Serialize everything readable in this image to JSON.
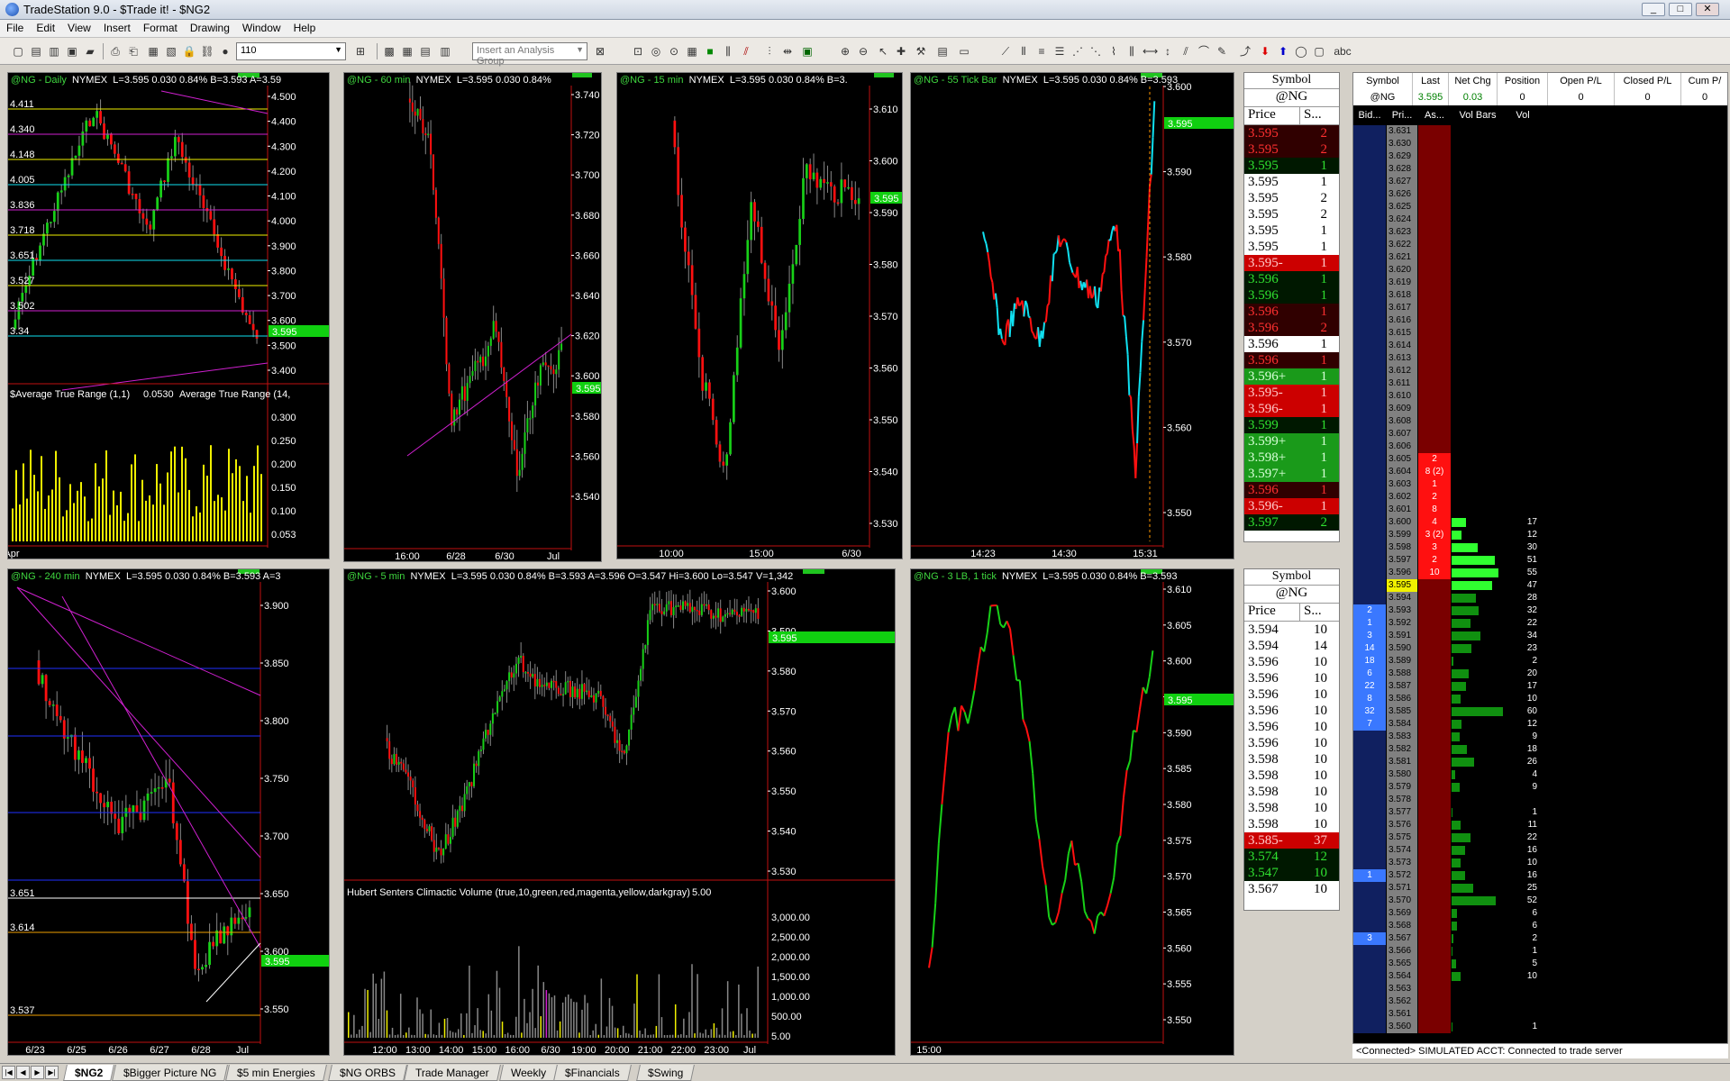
{
  "window": {
    "title": "TradeStation 9.0 - $Trade it! - $NG2",
    "min": "_",
    "max": "□",
    "close": "✕"
  },
  "menu": [
    "File",
    "Edit",
    "View",
    "Insert",
    "Format",
    "Drawing",
    "Window",
    "Help"
  ],
  "toolbar": {
    "interval_value": "110",
    "analysis_group_placeholder": "Insert an Analysis Group"
  },
  "charts": {
    "daily": {
      "title": "@NG - Daily",
      "exchange": "NYMEX",
      "info": "L=3.595  0.030  0.84%  B=3.593  A=3.59",
      "price_ticks": [
        "4.500",
        "4.400",
        "4.300",
        "4.200",
        "4.100",
        "4.000",
        "3.900",
        "3.800",
        "3.700",
        "3.600",
        "3.500",
        "3.400"
      ],
      "level_labels": [
        "4.411",
        "4.340",
        "4.148",
        "4.005",
        "3.836",
        "3.718",
        "3.651",
        "3.527",
        "3.502",
        "3.34"
      ],
      "indicator": "$Average True Range (1,1)",
      "indicator_val": "0.0530",
      "indicator2": "Average True Range (14,",
      "ind_ticks": [
        "0.300",
        "0.250",
        "0.200",
        "0.150",
        "0.100",
        "0.053"
      ],
      "last_tag": "3.595",
      "x_labels": [
        "Apr"
      ]
    },
    "m60": {
      "title": "@NG - 60 min",
      "exchange": "NYMEX",
      "info": "L=3.595  0.030  0.84%",
      "price_ticks": [
        "3.740",
        "3.720",
        "3.700",
        "3.680",
        "3.660",
        "3.640",
        "3.620",
        "3.600",
        "3.580",
        "3.560",
        "3.540"
      ],
      "last_tag": "3.595",
      "x_labels": [
        "16:00",
        "6/28",
        "6/30",
        "Jul"
      ]
    },
    "m15": {
      "title": "@NG - 15 min",
      "exchange": "NYMEX",
      "info": "L=3.595  0.030  0.84%  B=3.",
      "price_ticks": [
        "3.610",
        "3.600",
        "3.590",
        "3.580",
        "3.570",
        "3.560",
        "3.550",
        "3.540",
        "3.530"
      ],
      "last_tag": "3.595",
      "x_labels": [
        "10:00",
        "15:00",
        "6/30"
      ]
    },
    "tick55": {
      "title": "@NG - 55 Tick Bar",
      "exchange": "NYMEX",
      "info": "L=3.595  0.030  0.84%  B=3.593",
      "price_ticks": [
        "3.600",
        "3.590",
        "3.580",
        "3.570",
        "3.560",
        "3.550"
      ],
      "last_tag": "3.595",
      "x_labels": [
        "14:23",
        "14:30",
        "15:31"
      ]
    },
    "m240": {
      "title": "@NG - 240 min",
      "exchange": "NYMEX",
      "info": "L=3.595  0.030  0.84%  B=3.593  A=3",
      "price_ticks": [
        "3.900",
        "3.850",
        "3.800",
        "3.750",
        "3.700",
        "3.650",
        "3.600",
        "3.550"
      ],
      "level_labels": [
        "3.651",
        "3.614",
        "3.537"
      ],
      "last_tag": "3.595",
      "x_labels": [
        "6/23",
        "6/25",
        "6/26",
        "6/27",
        "6/28",
        "Jul"
      ]
    },
    "m5": {
      "title": "@NG - 5 min",
      "exchange": "NYMEX",
      "info": "L=3.595  0.030  0.84%  B=3.593  A=3.596  O=3.547  Hi=3.600  Lo=3.547  V=1,342",
      "price_ticks": [
        "3.600",
        "3.590",
        "3.580",
        "3.570",
        "3.560",
        "3.550",
        "3.540",
        "3.530"
      ],
      "indicator": "Hubert Senters Climactic Volume (true,10,green,red,magenta,yellow,darkgray)",
      "indicator_val": "5.00",
      "vol_ticks": [
        "3,000.00",
        "2,500.00",
        "2,000.00",
        "1,500.00",
        "1,000.00",
        "500.00",
        "5.00"
      ],
      "last_tag": "3.595",
      "x_labels": [
        "12:00",
        "13:00",
        "14:00",
        "15:00",
        "16:00",
        "6/30",
        "19:00",
        "20:00",
        "21:00",
        "22:00",
        "23:00",
        "Jul"
      ]
    },
    "lb3": {
      "title": "@NG - 3 LB, 1 tick",
      "exchange": "NYMEX",
      "info": "L=3.595  0.030  0.84%  B=3.593",
      "price_ticks": [
        "3.610",
        "3.605",
        "3.600",
        "3.595",
        "3.590",
        "3.585",
        "3.580",
        "3.575",
        "3.570",
        "3.565",
        "3.560",
        "3.555",
        "3.550"
      ],
      "last_tag": "3.595",
      "x_labels": [
        "15:00"
      ]
    }
  },
  "time_sales_1": {
    "sym_head": "Symbol",
    "symbol": "@NG",
    "col_price": "Price",
    "col_size": "S...",
    "rows": [
      [
        "3.595",
        "2",
        "dred"
      ],
      [
        "3.595",
        "2",
        "dred"
      ],
      [
        "3.595",
        "1",
        "dgreen"
      ],
      [
        "3.595",
        "1",
        "white"
      ],
      [
        "3.595",
        "2",
        "white"
      ],
      [
        "3.595",
        "2",
        "white"
      ],
      [
        "3.595",
        "1",
        "white"
      ],
      [
        "3.595",
        "1",
        "white"
      ],
      [
        "3.595-",
        "1",
        "red"
      ],
      [
        "3.596",
        "1",
        "dgreen"
      ],
      [
        "3.596",
        "1",
        "dgreen"
      ],
      [
        "3.596",
        "1",
        "dred"
      ],
      [
        "3.596",
        "2",
        "dred"
      ],
      [
        "3.596",
        "1",
        "white"
      ],
      [
        "3.596",
        "1",
        "dred"
      ],
      [
        "3.596+",
        "1",
        "green"
      ],
      [
        "3.595-",
        "1",
        "red"
      ],
      [
        "3.596-",
        "1",
        "red"
      ],
      [
        "3.599",
        "1",
        "dgreen"
      ],
      [
        "3.599+",
        "1",
        "green"
      ],
      [
        "3.598+",
        "1",
        "green"
      ],
      [
        "3.597+",
        "1",
        "green"
      ],
      [
        "3.596",
        "1",
        "dred"
      ],
      [
        "3.596-",
        "1",
        "red"
      ],
      [
        "3.597",
        "2",
        "dgreen"
      ]
    ]
  },
  "time_sales_2": {
    "sym_head": "Symbol",
    "symbol": "@NG",
    "col_price": "Price",
    "col_size": "S...",
    "rows": [
      [
        "3.594",
        "10",
        "white"
      ],
      [
        "3.594",
        "14",
        "white"
      ],
      [
        "3.596",
        "10",
        "white"
      ],
      [
        "3.596",
        "10",
        "white"
      ],
      [
        "3.596",
        "10",
        "white"
      ],
      [
        "3.596",
        "10",
        "white"
      ],
      [
        "3.596",
        "10",
        "white"
      ],
      [
        "3.596",
        "10",
        "white"
      ],
      [
        "3.598",
        "10",
        "white"
      ],
      [
        "3.598",
        "10",
        "white"
      ],
      [
        "3.598",
        "10",
        "white"
      ],
      [
        "3.598",
        "10",
        "white"
      ],
      [
        "3.598",
        "10",
        "white"
      ],
      [
        "3.585-",
        "37",
        "red"
      ],
      [
        "3.574",
        "12",
        "dgreen"
      ],
      [
        "3.547",
        "10",
        "dgreen"
      ],
      [
        "3.567",
        "10",
        "white"
      ]
    ]
  },
  "dom": {
    "headers": [
      "Symbol",
      "Last",
      "Net Chg",
      "Position",
      "Open P/L",
      "Closed P/L",
      "Cum P/"
    ],
    "values": [
      "@NG",
      "3.595",
      "0.03",
      "0",
      "0",
      "0",
      "0"
    ],
    "sub_headers": [
      "Bid...",
      "Pri...",
      "As...",
      "Vol Bars",
      "Vol"
    ],
    "ladder": [
      [
        "",
        "3.631",
        "",
        ""
      ],
      [
        "",
        "3.630",
        "",
        ""
      ],
      [
        "",
        "3.629",
        "",
        ""
      ],
      [
        "",
        "3.628",
        "",
        ""
      ],
      [
        "",
        "3.627",
        "",
        ""
      ],
      [
        "",
        "3.626",
        "",
        ""
      ],
      [
        "",
        "3.625",
        "",
        ""
      ],
      [
        "",
        "3.624",
        "",
        ""
      ],
      [
        "",
        "3.623",
        "",
        ""
      ],
      [
        "",
        "3.622",
        "",
        ""
      ],
      [
        "",
        "3.621",
        "",
        ""
      ],
      [
        "",
        "3.620",
        "",
        ""
      ],
      [
        "",
        "3.619",
        "",
        ""
      ],
      [
        "",
        "3.618",
        "",
        ""
      ],
      [
        "",
        "3.617",
        "",
        ""
      ],
      [
        "",
        "3.616",
        "",
        ""
      ],
      [
        "",
        "3.615",
        "",
        ""
      ],
      [
        "",
        "3.614",
        "",
        ""
      ],
      [
        "",
        "3.613",
        "",
        ""
      ],
      [
        "",
        "3.612",
        "",
        ""
      ],
      [
        "",
        "3.611",
        "",
        ""
      ],
      [
        "",
        "3.610",
        "",
        ""
      ],
      [
        "",
        "3.609",
        "",
        ""
      ],
      [
        "",
        "3.608",
        "",
        ""
      ],
      [
        "",
        "3.607",
        "",
        ""
      ],
      [
        "",
        "3.606",
        "",
        ""
      ],
      [
        "",
        "3.605",
        "2",
        ""
      ],
      [
        "",
        "3.604",
        "8 (2)",
        ""
      ],
      [
        "",
        "3.603",
        "1",
        ""
      ],
      [
        "",
        "3.602",
        "2",
        ""
      ],
      [
        "",
        "3.601",
        "8",
        ""
      ],
      [
        "",
        "3.600",
        "4",
        "17"
      ],
      [
        "",
        "3.599",
        "3 (2)",
        "12"
      ],
      [
        "",
        "3.598",
        "3",
        "30"
      ],
      [
        "",
        "3.597",
        "2",
        "51"
      ],
      [
        "",
        "3.596",
        "10",
        "55"
      ],
      [
        "",
        "3.595",
        "",
        "47"
      ],
      [
        "",
        "3.594",
        "",
        "28"
      ],
      [
        "2",
        "3.593",
        "",
        "32"
      ],
      [
        "1",
        "3.592",
        "",
        "22"
      ],
      [
        "3",
        "3.591",
        "",
        "34"
      ],
      [
        "14",
        "3.590",
        "",
        "23"
      ],
      [
        "18",
        "3.589",
        "",
        "2"
      ],
      [
        "6",
        "3.588",
        "",
        "20"
      ],
      [
        "22",
        "3.587",
        "",
        "17"
      ],
      [
        "8",
        "3.586",
        "",
        "10"
      ],
      [
        "32",
        "3.585",
        "",
        "60"
      ],
      [
        "7",
        "3.584",
        "",
        "12"
      ],
      [
        "",
        "3.583",
        "",
        "9"
      ],
      [
        "",
        "3.582",
        "",
        "18"
      ],
      [
        "",
        "3.581",
        "",
        "26"
      ],
      [
        "",
        "3.580",
        "",
        "4"
      ],
      [
        "",
        "3.579",
        "",
        "9"
      ],
      [
        "",
        "3.578",
        "",
        ""
      ],
      [
        "",
        "3.577",
        "",
        "1"
      ],
      [
        "",
        "3.576",
        "",
        "11"
      ],
      [
        "",
        "3.575",
        "",
        "22"
      ],
      [
        "",
        "3.574",
        "",
        "16"
      ],
      [
        "",
        "3.573",
        "",
        "10"
      ],
      [
        "1",
        "3.572",
        "",
        "16"
      ],
      [
        "",
        "3.571",
        "",
        "25"
      ],
      [
        "",
        "3.570",
        "",
        "52"
      ],
      [
        "",
        "3.569",
        "",
        "6"
      ],
      [
        "",
        "3.568",
        "",
        "6"
      ],
      [
        "3",
        "3.567",
        "",
        "2"
      ],
      [
        "",
        "3.566",
        "",
        "1"
      ],
      [
        "",
        "3.565",
        "",
        "5"
      ],
      [
        "",
        "3.564",
        "",
        "10"
      ],
      [
        "",
        "3.563",
        "",
        ""
      ],
      [
        "",
        "3.562",
        "",
        ""
      ],
      [
        "",
        "3.561",
        "",
        ""
      ],
      [
        "",
        "3.560",
        "",
        "1"
      ]
    ]
  },
  "status": "<Connected> SIMULATED ACCT: Connected to trade server",
  "tabs": [
    "$NG2",
    "$Bigger Picture NG",
    "$5 min Energies",
    "$NG ORBS",
    "Trade Manager",
    "Weekly",
    "$Financials",
    "$Swing"
  ],
  "colors": {
    "up": "#18d018",
    "down": "#ff1010",
    "cyan": "#10e0f0",
    "yellow": "#f0f000",
    "magenta": "#d020d0",
    "last_tag": "#10d010"
  }
}
